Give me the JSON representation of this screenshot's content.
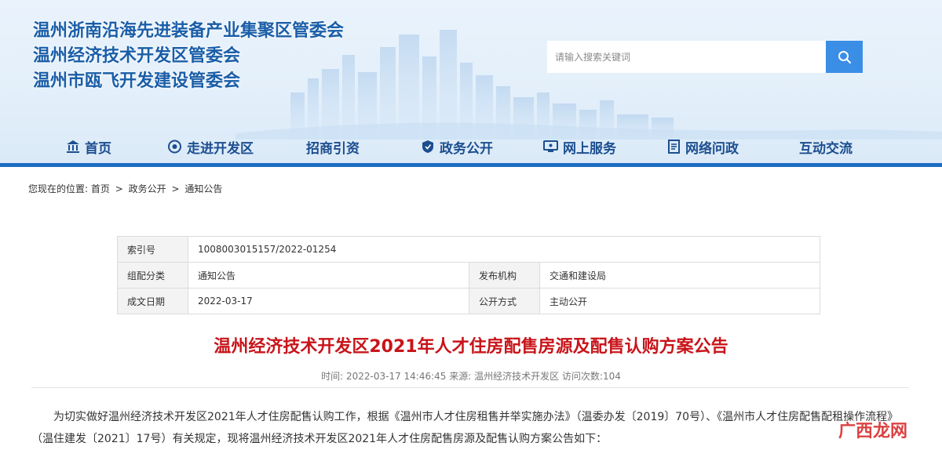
{
  "header": {
    "titles": [
      "温州浙南沿海先进装备产业集聚区管委会",
      "温州经济技术开发区管委会",
      "温州市瓯飞开发建设管委会"
    ],
    "search": {
      "placeholder": "请输入搜索关键词"
    }
  },
  "nav": {
    "items": [
      {
        "label": "首页",
        "icon": "bank-icon"
      },
      {
        "label": "走进开发区",
        "icon": "eye-icon"
      },
      {
        "label": "招商引资",
        "icon": ""
      },
      {
        "label": "政务公开",
        "icon": "shield-icon"
      },
      {
        "label": "网上服务",
        "icon": "monitor-icon"
      },
      {
        "label": "网络问政",
        "icon": "document-icon"
      },
      {
        "label": "互动交流",
        "icon": ""
      }
    ]
  },
  "breadcrumb": {
    "prefix": "您现在的位置:",
    "items": [
      "首页",
      "政务公开",
      "通知公告"
    ],
    "separator": ">"
  },
  "info": {
    "index_label": "索引号",
    "index_value": "1008003015157/2022-01254",
    "category_label": "组配分类",
    "category_value": "通知公告",
    "publisher_label": "发布机构",
    "publisher_value": "交通和建设局",
    "date_label": "成文日期",
    "date_value": "2022-03-17",
    "open_label": "公开方式",
    "open_value": "主动公开"
  },
  "article": {
    "title": "温州经济技术开发区2021年人才住房配售房源及配售认购方案公告",
    "meta": "时间: 2022-03-17 14:46:45 来源: 温州经济技术开发区 访问次数:104",
    "body": "为切实做好温州经济技术开发区2021年人才住房配售认购工作，根据《温州市人才住房租售并举实施办法》（温委办发〔2019〕70号）、《温州市人才住房配售配租操作流程》（温住建发〔2021〕17号）有关规定，现将温州经济技术开发区2021年人才住房配售房源及配售认购方案公告如下："
  },
  "watermark": "广西龙网",
  "colors": {
    "title_blue": "#1a5ea8",
    "nav_blue": "#1c4e8f",
    "accent": "#1e6cc4",
    "search_button": "#3a8ee6",
    "article_title_red": "#c8141a"
  }
}
